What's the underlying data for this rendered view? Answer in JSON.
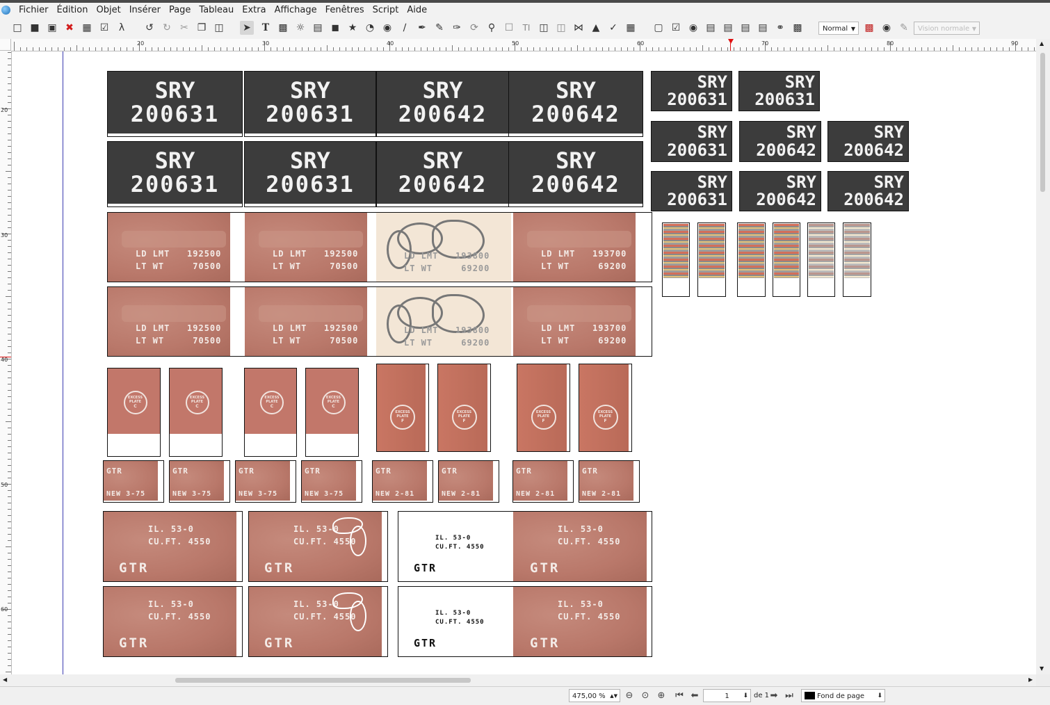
{
  "menu": [
    "Fichier",
    "Édition",
    "Objet",
    "Insérer",
    "Page",
    "Tableau",
    "Extra",
    "Affichage",
    "Fenêtres",
    "Script",
    "Aide"
  ],
  "toolbar": {
    "icons": [
      "new-doc",
      "open",
      "save",
      "close",
      "print",
      "preflight",
      "export-pdf",
      "undo",
      "redo",
      "cut",
      "copy",
      "paste",
      "select",
      "text-frame",
      "image-frame",
      "render-frame",
      "table",
      "shape",
      "polygon",
      "arc",
      "spiral",
      "line",
      "bezier",
      "freehand",
      "calligraphic",
      "rotate",
      "zoom",
      "edit-content",
      "edit-text",
      "link-frames",
      "unlink-frames",
      "measure",
      "copy-properties",
      "eyedropper",
      "pdf-tools",
      "pdf-button",
      "pdf-checkbox",
      "pdf-radio",
      "pdf-textfield",
      "pdf-combo",
      "pdf-list",
      "pdf-annotation",
      "pdf-link",
      "pdf-3d"
    ],
    "mode_select": "Normal",
    "view_select": "Vision normale"
  },
  "ruler": {
    "h_labels": [
      "20",
      "30",
      "40",
      "50",
      "60",
      "70",
      "80",
      "90"
    ],
    "v_labels": [
      "20",
      "30",
      "40",
      "50",
      "60"
    ]
  },
  "artwork": {
    "sry_top": "SRY",
    "sry_a": "200631",
    "sry_b": "200642",
    "ld_lmt_a": "LD LMT   192500",
    "lt_wt_a": "LT WT     70500",
    "ld_lmt_b": "LD LMT   193700",
    "lt_wt_b": "LT WT     69200",
    "graffiti_ld": "LD LMT   193800",
    "graffiti_lt": "LT WT     69200",
    "excess_l1": "EXCESS",
    "excess_l2": "PLATE",
    "excess_c": "C",
    "excess_f": "F",
    "gtr": "GTR",
    "new_a": "NEW 3-75",
    "new_b": "NEW 2-81",
    "il": "IL. 53-0",
    "cuft": "CU.FT. 4550"
  },
  "status": {
    "zoom": "475,00 %",
    "page": "1",
    "page_of": "de 1",
    "layer": "Fond de page"
  }
}
